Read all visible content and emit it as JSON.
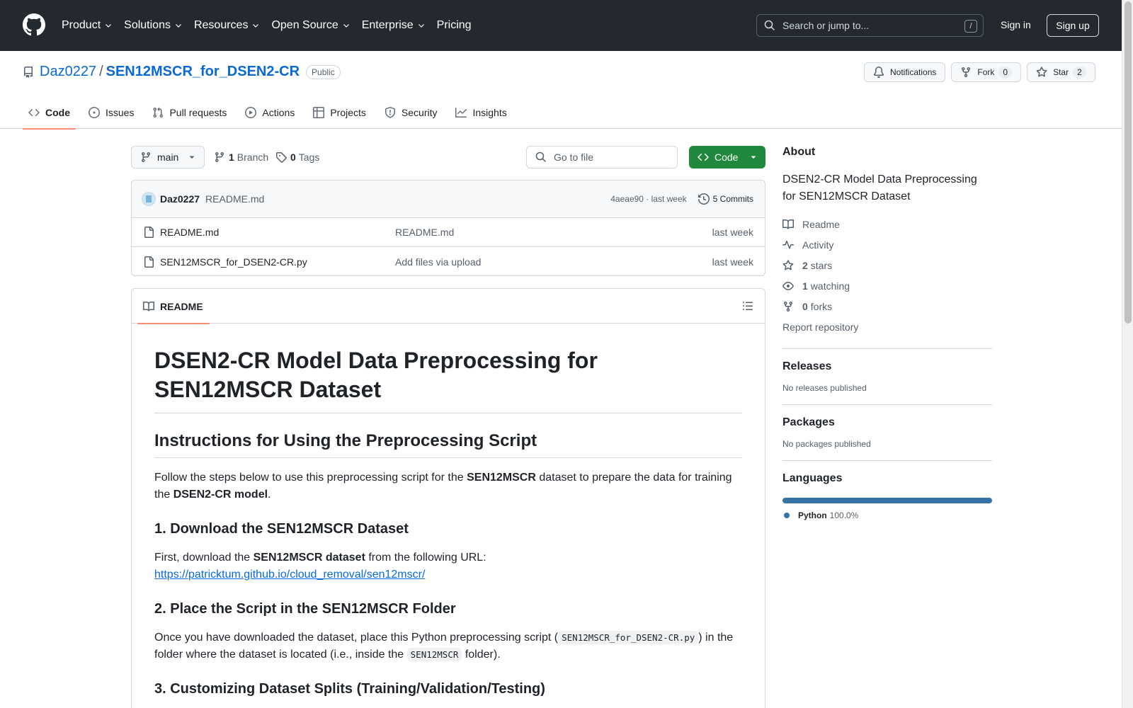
{
  "header": {
    "nav": [
      "Product",
      "Solutions",
      "Resources",
      "Open Source",
      "Enterprise",
      "Pricing"
    ],
    "search_placeholder": "Search or jump to...",
    "search_shortcut": "/",
    "sign_in": "Sign in",
    "sign_up": "Sign up"
  },
  "repo": {
    "owner": "Daz0227",
    "separator": "/",
    "name": "SEN12MSCR_for_DSEN2-CR",
    "visibility": "Public",
    "notifications_label": "Notifications",
    "fork_label": "Fork",
    "fork_count": "0",
    "star_label": "Star",
    "star_count": "2",
    "tabs": [
      "Code",
      "Issues",
      "Pull requests",
      "Actions",
      "Projects",
      "Security",
      "Insights"
    ]
  },
  "toolbar": {
    "branch": "main",
    "branch_count": "1",
    "branch_label": "Branch",
    "tag_count": "0",
    "tag_label": "Tags",
    "goto_placeholder": "Go to file",
    "code_label": "Code"
  },
  "commit": {
    "author": "Daz0227",
    "message": "README.md",
    "meta": "4aeae90 · last week",
    "commits": "5 Commits"
  },
  "files": [
    {
      "name": "README.md",
      "message": "README.md",
      "date": "last week"
    },
    {
      "name": "SEN12MSCR_for_DSEN2-CR.py",
      "message": "Add files via upload",
      "date": "last week"
    }
  ],
  "readme": {
    "tab_label": "README",
    "h1": "DSEN2-CR Model Data Preprocessing for SEN12MSCR Dataset",
    "h2": "Instructions for Using the Preprocessing Script",
    "intro_1": "Follow the steps below to use this preprocessing script for the ",
    "intro_b1": "SEN12MSCR",
    "intro_2": " dataset to prepare the data for training the ",
    "intro_b2": "DSEN2-CR model",
    "intro_3": ".",
    "s1_title": "1. Download the SEN12MSCR Dataset",
    "s1_text_1": "First, download the ",
    "s1_bold": "SEN12MSCR dataset",
    "s1_text_2": " from the following URL:",
    "s1_link": "https://patricktum.github.io/cloud_removal/sen12mscr/",
    "s2_title": "2. Place the Script in the SEN12MSCR Folder",
    "s2_text_1": "Once you have downloaded the dataset, place this Python preprocessing script (",
    "s2_code1": "SEN12MSCR_for_DSEN2-CR.py",
    "s2_text_2": ") in the folder where the dataset is located (i.e., inside the ",
    "s2_code2": "SEN12MSCR",
    "s2_text_3": " folder).",
    "s3_title": "3. Customizing Dataset Splits (Training/Validation/Testing)"
  },
  "sidebar": {
    "about_title": "About",
    "about_desc": "DSEN2-CR Model Data Preprocessing for SEN12MSCR Dataset",
    "readme": "Readme",
    "activity": "Activity",
    "stars_count": "2",
    "stars_label": "stars",
    "watching_count": "1",
    "watching_label": "watching",
    "forks_count": "0",
    "forks_label": "forks",
    "report": "Report repository",
    "releases_title": "Releases",
    "releases_text": "No releases published",
    "packages_title": "Packages",
    "packages_text": "No packages published",
    "languages_title": "Languages",
    "language_name": "Python",
    "language_pct": "100.0%",
    "language_color": "#3572A5"
  }
}
